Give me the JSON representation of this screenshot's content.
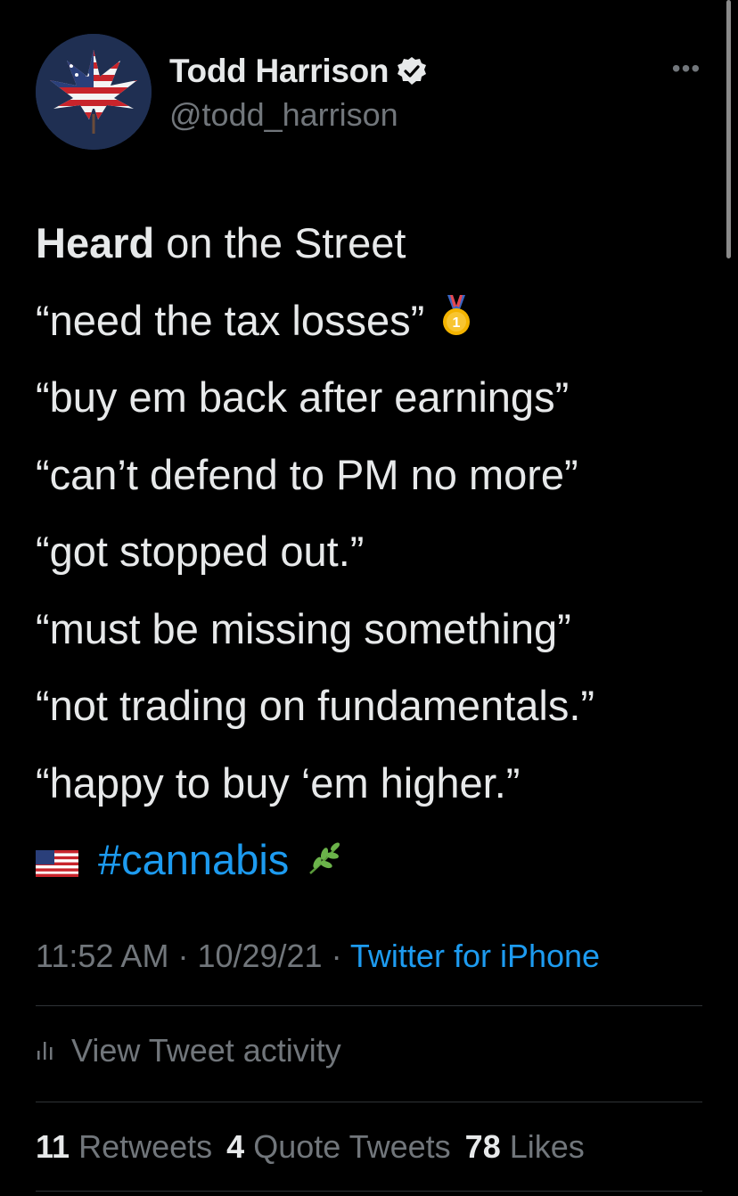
{
  "author": {
    "display_name": "Todd Harrison",
    "handle": "@todd_harrison",
    "verified": true,
    "avatar_icon": "usa-flag-cannabis-leaf-avatar"
  },
  "more_menu_label": "•••",
  "tweet": {
    "lines": [
      {
        "bold": "Heard",
        "text": " on the Street"
      },
      {
        "text": "“need the tax losses”",
        "trailing_icon": "gold-medal-icon"
      },
      {
        "text": "“buy em back after earnings”"
      },
      {
        "text": "“can’t defend to PM no more”"
      },
      {
        "text": "“got stopped out.”"
      },
      {
        "text": "“must be missing something”"
      },
      {
        "text": "“not trading on fundamentals.”"
      },
      {
        "text": "“happy to buy ‘em higher.”"
      }
    ],
    "hashtag": "#cannabis",
    "hashtag_leading_icon": "us-flag-icon",
    "hashtag_trailing_icon": "herb-icon"
  },
  "meta": {
    "time": "11:52 AM",
    "separator": " · ",
    "date": "10/29/21",
    "source": "Twitter for iPhone"
  },
  "activity": {
    "label": "View Tweet activity",
    "icon": "bar-chart-icon"
  },
  "stats": {
    "retweets_count": "11",
    "retweets_label": "Retweets",
    "quote_count": "4",
    "quote_label": "Quote Tweets",
    "likes_count": "78",
    "likes_label": "Likes"
  },
  "colors": {
    "background": "#000000",
    "primary_text": "#e7e9ea",
    "secondary_text": "#71767b",
    "link": "#1d9bf0",
    "divider": "#2f3336"
  }
}
